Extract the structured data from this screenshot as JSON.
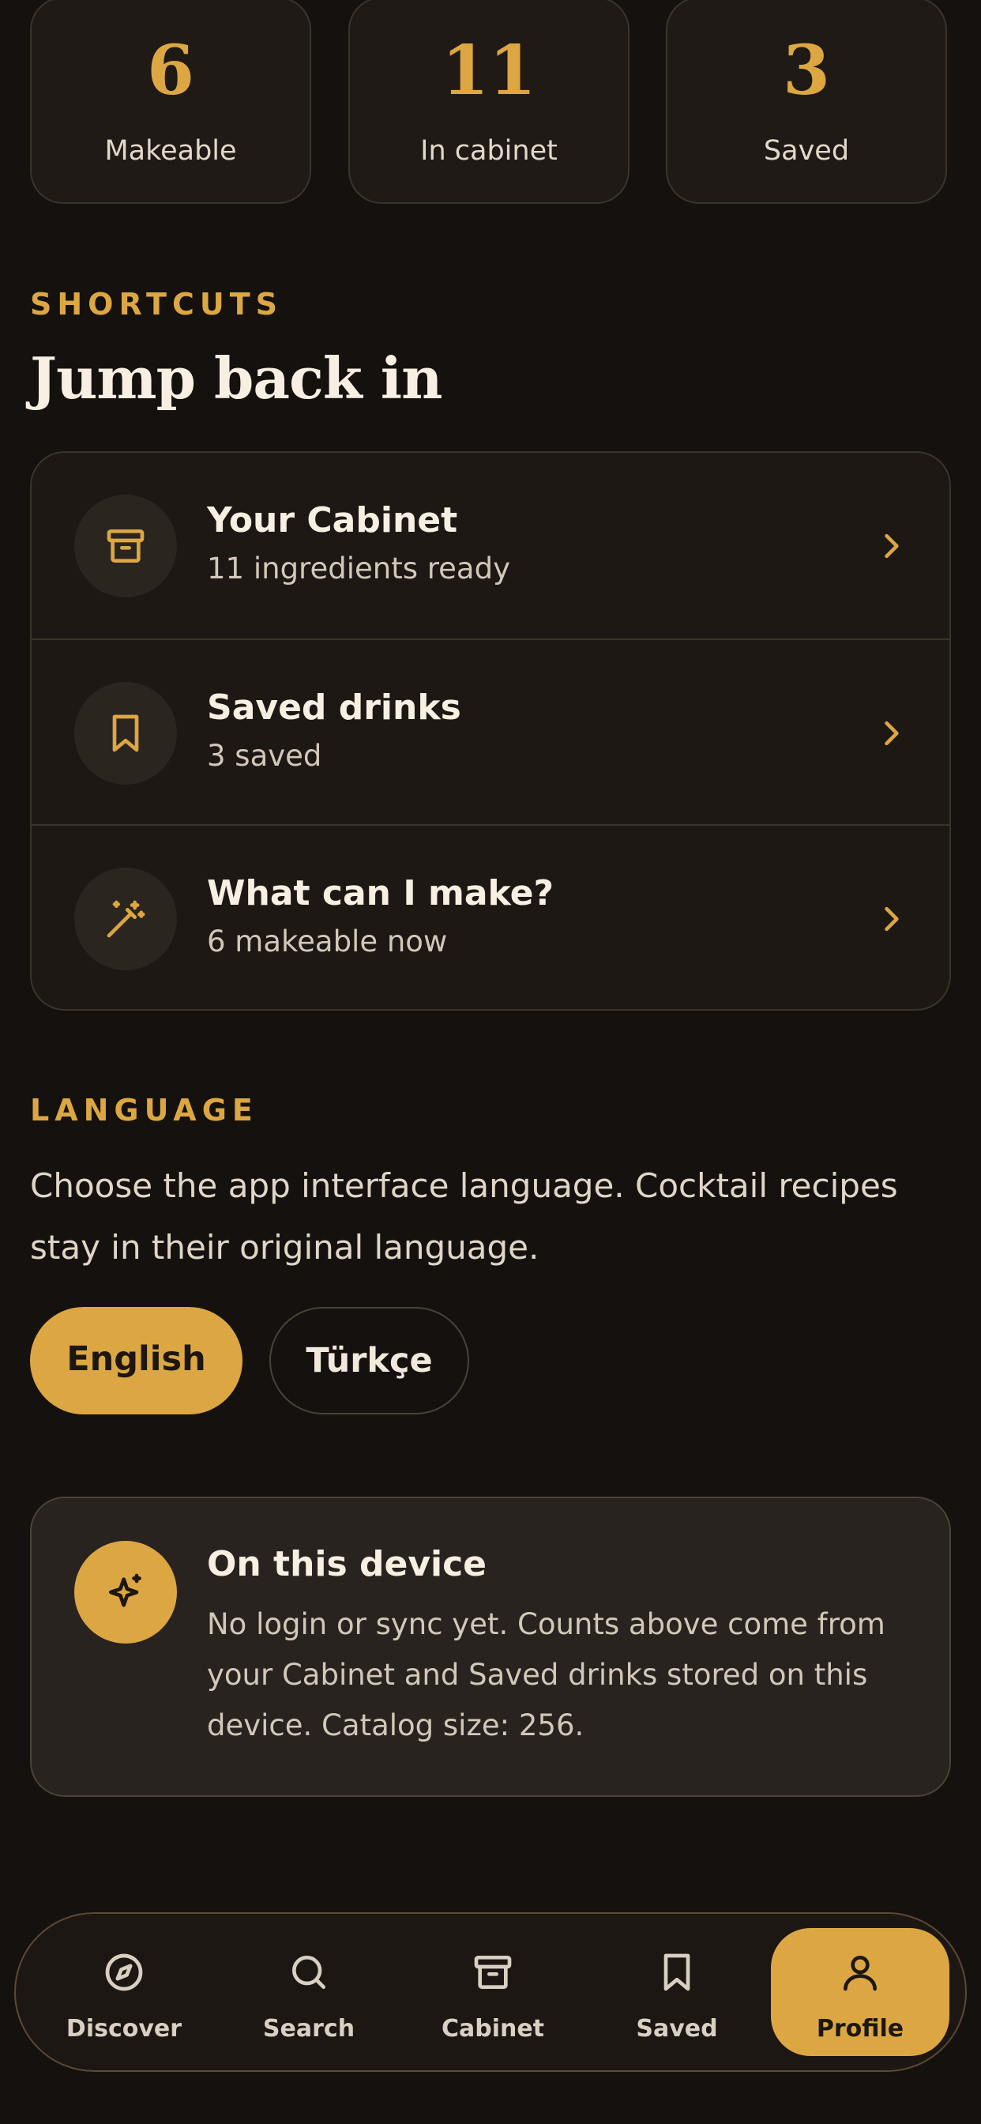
{
  "stats": [
    {
      "value": "6",
      "label": "Makeable"
    },
    {
      "value": "11",
      "label": "In cabinet"
    },
    {
      "value": "3",
      "label": "Saved"
    }
  ],
  "shortcuts": {
    "eyebrow": "SHORTCUTS",
    "heading": "Jump back in",
    "items": [
      {
        "title": "Your Cabinet",
        "subtitle": "11 ingredients ready",
        "icon": "archive-icon"
      },
      {
        "title": "Saved drinks",
        "subtitle": "3 saved",
        "icon": "bookmark-icon"
      },
      {
        "title": "What can I make?",
        "subtitle": "6 makeable now",
        "icon": "magic-wand-icon"
      }
    ]
  },
  "language": {
    "eyebrow": "LANGUAGE",
    "description": "Choose the app interface language. Cocktail recipes stay in their original language.",
    "options": [
      {
        "label": "English",
        "selected": true
      },
      {
        "label": "Türkçe",
        "selected": false
      }
    ]
  },
  "device": {
    "title": "On this device",
    "text": "No login or sync yet. Counts above come from your Cabinet and Saved drinks stored on this device. Catalog size: 256.",
    "icon": "sparkle-icon"
  },
  "nav": {
    "items": [
      {
        "label": "Discover",
        "icon": "compass-icon",
        "active": false
      },
      {
        "label": "Search",
        "icon": "search-icon",
        "active": false
      },
      {
        "label": "Cabinet",
        "icon": "archive-icon",
        "active": false
      },
      {
        "label": "Saved",
        "icon": "bookmark-icon",
        "active": false
      },
      {
        "label": "Profile",
        "icon": "user-icon",
        "active": true
      }
    ]
  },
  "colors": {
    "accent": "#dca743",
    "background": "#15110e",
    "card": "#1f1a16"
  }
}
